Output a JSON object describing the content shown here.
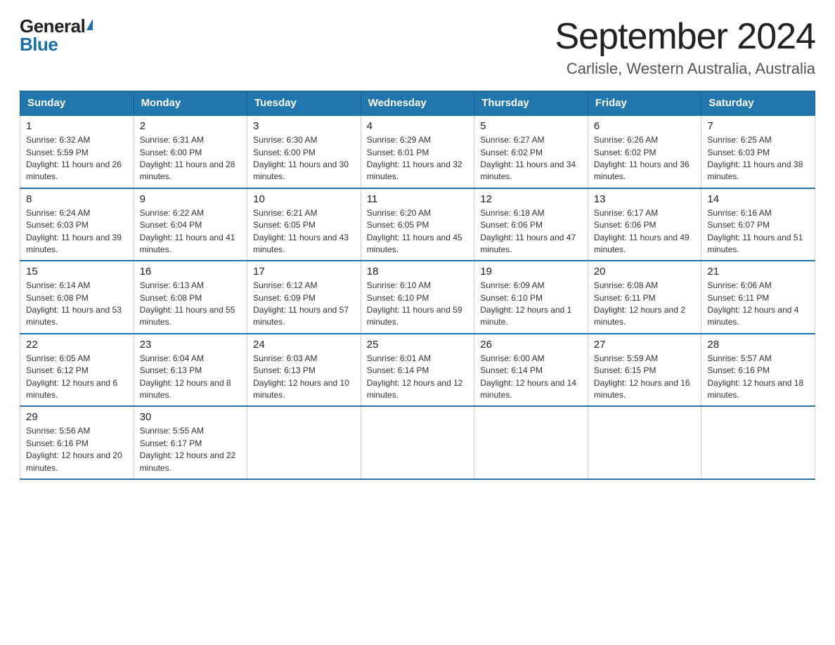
{
  "logo": {
    "general": "General",
    "blue": "Blue"
  },
  "title": {
    "month_year": "September 2024",
    "location": "Carlisle, Western Australia, Australia"
  },
  "days_of_week": [
    "Sunday",
    "Monday",
    "Tuesday",
    "Wednesday",
    "Thursday",
    "Friday",
    "Saturday"
  ],
  "weeks": [
    [
      {
        "day": "1",
        "sunrise": "6:32 AM",
        "sunset": "5:59 PM",
        "daylight": "11 hours and 26 minutes."
      },
      {
        "day": "2",
        "sunrise": "6:31 AM",
        "sunset": "6:00 PM",
        "daylight": "11 hours and 28 minutes."
      },
      {
        "day": "3",
        "sunrise": "6:30 AM",
        "sunset": "6:00 PM",
        "daylight": "11 hours and 30 minutes."
      },
      {
        "day": "4",
        "sunrise": "6:29 AM",
        "sunset": "6:01 PM",
        "daylight": "11 hours and 32 minutes."
      },
      {
        "day": "5",
        "sunrise": "6:27 AM",
        "sunset": "6:02 PM",
        "daylight": "11 hours and 34 minutes."
      },
      {
        "day": "6",
        "sunrise": "6:26 AM",
        "sunset": "6:02 PM",
        "daylight": "11 hours and 36 minutes."
      },
      {
        "day": "7",
        "sunrise": "6:25 AM",
        "sunset": "6:03 PM",
        "daylight": "11 hours and 38 minutes."
      }
    ],
    [
      {
        "day": "8",
        "sunrise": "6:24 AM",
        "sunset": "6:03 PM",
        "daylight": "11 hours and 39 minutes."
      },
      {
        "day": "9",
        "sunrise": "6:22 AM",
        "sunset": "6:04 PM",
        "daylight": "11 hours and 41 minutes."
      },
      {
        "day": "10",
        "sunrise": "6:21 AM",
        "sunset": "6:05 PM",
        "daylight": "11 hours and 43 minutes."
      },
      {
        "day": "11",
        "sunrise": "6:20 AM",
        "sunset": "6:05 PM",
        "daylight": "11 hours and 45 minutes."
      },
      {
        "day": "12",
        "sunrise": "6:18 AM",
        "sunset": "6:06 PM",
        "daylight": "11 hours and 47 minutes."
      },
      {
        "day": "13",
        "sunrise": "6:17 AM",
        "sunset": "6:06 PM",
        "daylight": "11 hours and 49 minutes."
      },
      {
        "day": "14",
        "sunrise": "6:16 AM",
        "sunset": "6:07 PM",
        "daylight": "11 hours and 51 minutes."
      }
    ],
    [
      {
        "day": "15",
        "sunrise": "6:14 AM",
        "sunset": "6:08 PM",
        "daylight": "11 hours and 53 minutes."
      },
      {
        "day": "16",
        "sunrise": "6:13 AM",
        "sunset": "6:08 PM",
        "daylight": "11 hours and 55 minutes."
      },
      {
        "day": "17",
        "sunrise": "6:12 AM",
        "sunset": "6:09 PM",
        "daylight": "11 hours and 57 minutes."
      },
      {
        "day": "18",
        "sunrise": "6:10 AM",
        "sunset": "6:10 PM",
        "daylight": "11 hours and 59 minutes."
      },
      {
        "day": "19",
        "sunrise": "6:09 AM",
        "sunset": "6:10 PM",
        "daylight": "12 hours and 1 minute."
      },
      {
        "day": "20",
        "sunrise": "6:08 AM",
        "sunset": "6:11 PM",
        "daylight": "12 hours and 2 minutes."
      },
      {
        "day": "21",
        "sunrise": "6:06 AM",
        "sunset": "6:11 PM",
        "daylight": "12 hours and 4 minutes."
      }
    ],
    [
      {
        "day": "22",
        "sunrise": "6:05 AM",
        "sunset": "6:12 PM",
        "daylight": "12 hours and 6 minutes."
      },
      {
        "day": "23",
        "sunrise": "6:04 AM",
        "sunset": "6:13 PM",
        "daylight": "12 hours and 8 minutes."
      },
      {
        "day": "24",
        "sunrise": "6:03 AM",
        "sunset": "6:13 PM",
        "daylight": "12 hours and 10 minutes."
      },
      {
        "day": "25",
        "sunrise": "6:01 AM",
        "sunset": "6:14 PM",
        "daylight": "12 hours and 12 minutes."
      },
      {
        "day": "26",
        "sunrise": "6:00 AM",
        "sunset": "6:14 PM",
        "daylight": "12 hours and 14 minutes."
      },
      {
        "day": "27",
        "sunrise": "5:59 AM",
        "sunset": "6:15 PM",
        "daylight": "12 hours and 16 minutes."
      },
      {
        "day": "28",
        "sunrise": "5:57 AM",
        "sunset": "6:16 PM",
        "daylight": "12 hours and 18 minutes."
      }
    ],
    [
      {
        "day": "29",
        "sunrise": "5:56 AM",
        "sunset": "6:16 PM",
        "daylight": "12 hours and 20 minutes."
      },
      {
        "day": "30",
        "sunrise": "5:55 AM",
        "sunset": "6:17 PM",
        "daylight": "12 hours and 22 minutes."
      },
      null,
      null,
      null,
      null,
      null
    ]
  ],
  "labels": {
    "sunrise": "Sunrise:",
    "sunset": "Sunset:",
    "daylight": "Daylight:"
  }
}
